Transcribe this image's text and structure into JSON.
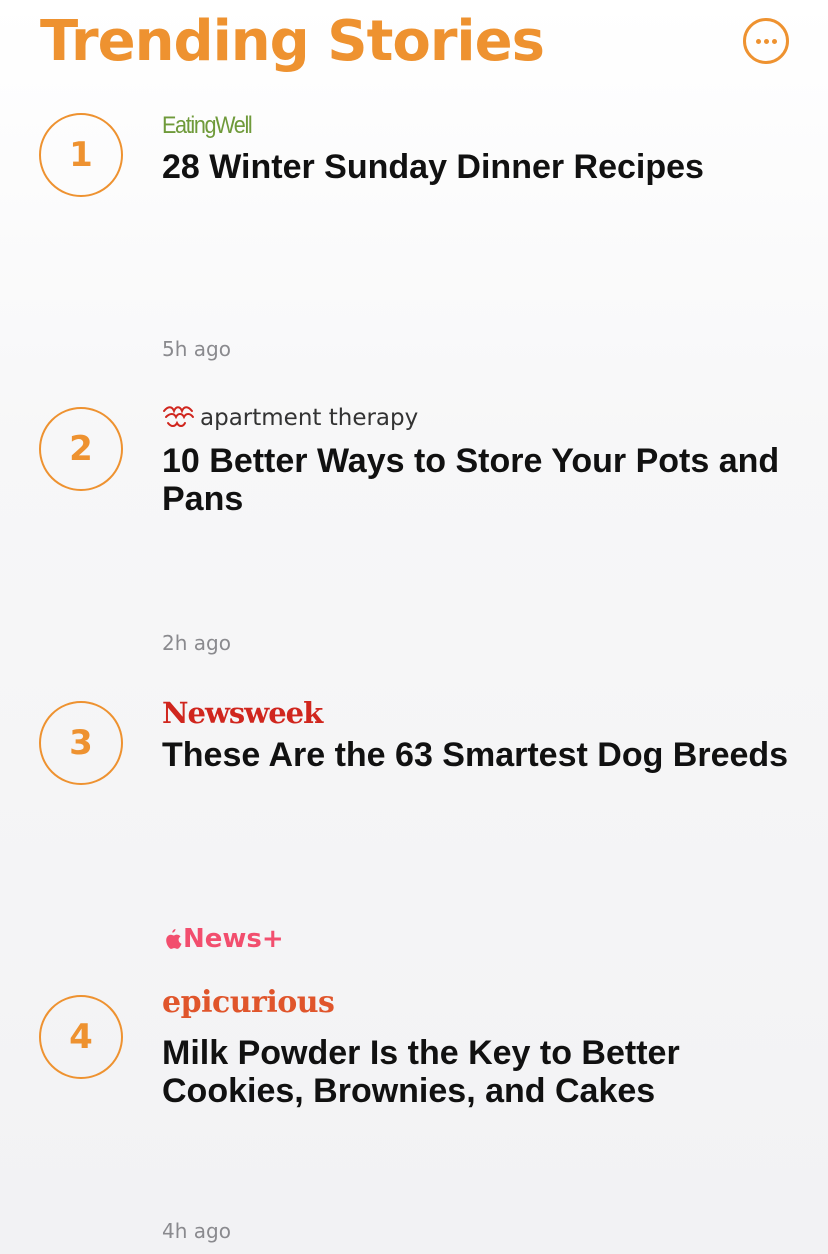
{
  "header": {
    "title": "Trending Stories",
    "more_icon": "ellipsis-circle-icon"
  },
  "stories": [
    {
      "rank": "1",
      "publisher": "EatingWell",
      "headline": "28 Winter Sunday Dinner Recipes",
      "time": "5h ago"
    },
    {
      "rank": "2",
      "publisher": "apartment therapy",
      "headline": "10 Better Ways to Store Your Pots and Pans",
      "time": "2h ago"
    },
    {
      "rank": "3",
      "publisher": "Newsweek",
      "headline": "These Are the 63 Smartest Dog Breeds",
      "badge": "News+"
    },
    {
      "rank": "4",
      "publisher": "epicurious",
      "headline": "Milk Powder Is the Key to Better Cookies, Brownies, and Cakes",
      "time": "4h ago"
    }
  ],
  "colors": {
    "accent": "#EE9230",
    "newsplus": "#F24E6E",
    "newsweek": "#D0261E",
    "epicurious": "#E0552B",
    "eatingwell": "#6f9a3a"
  }
}
